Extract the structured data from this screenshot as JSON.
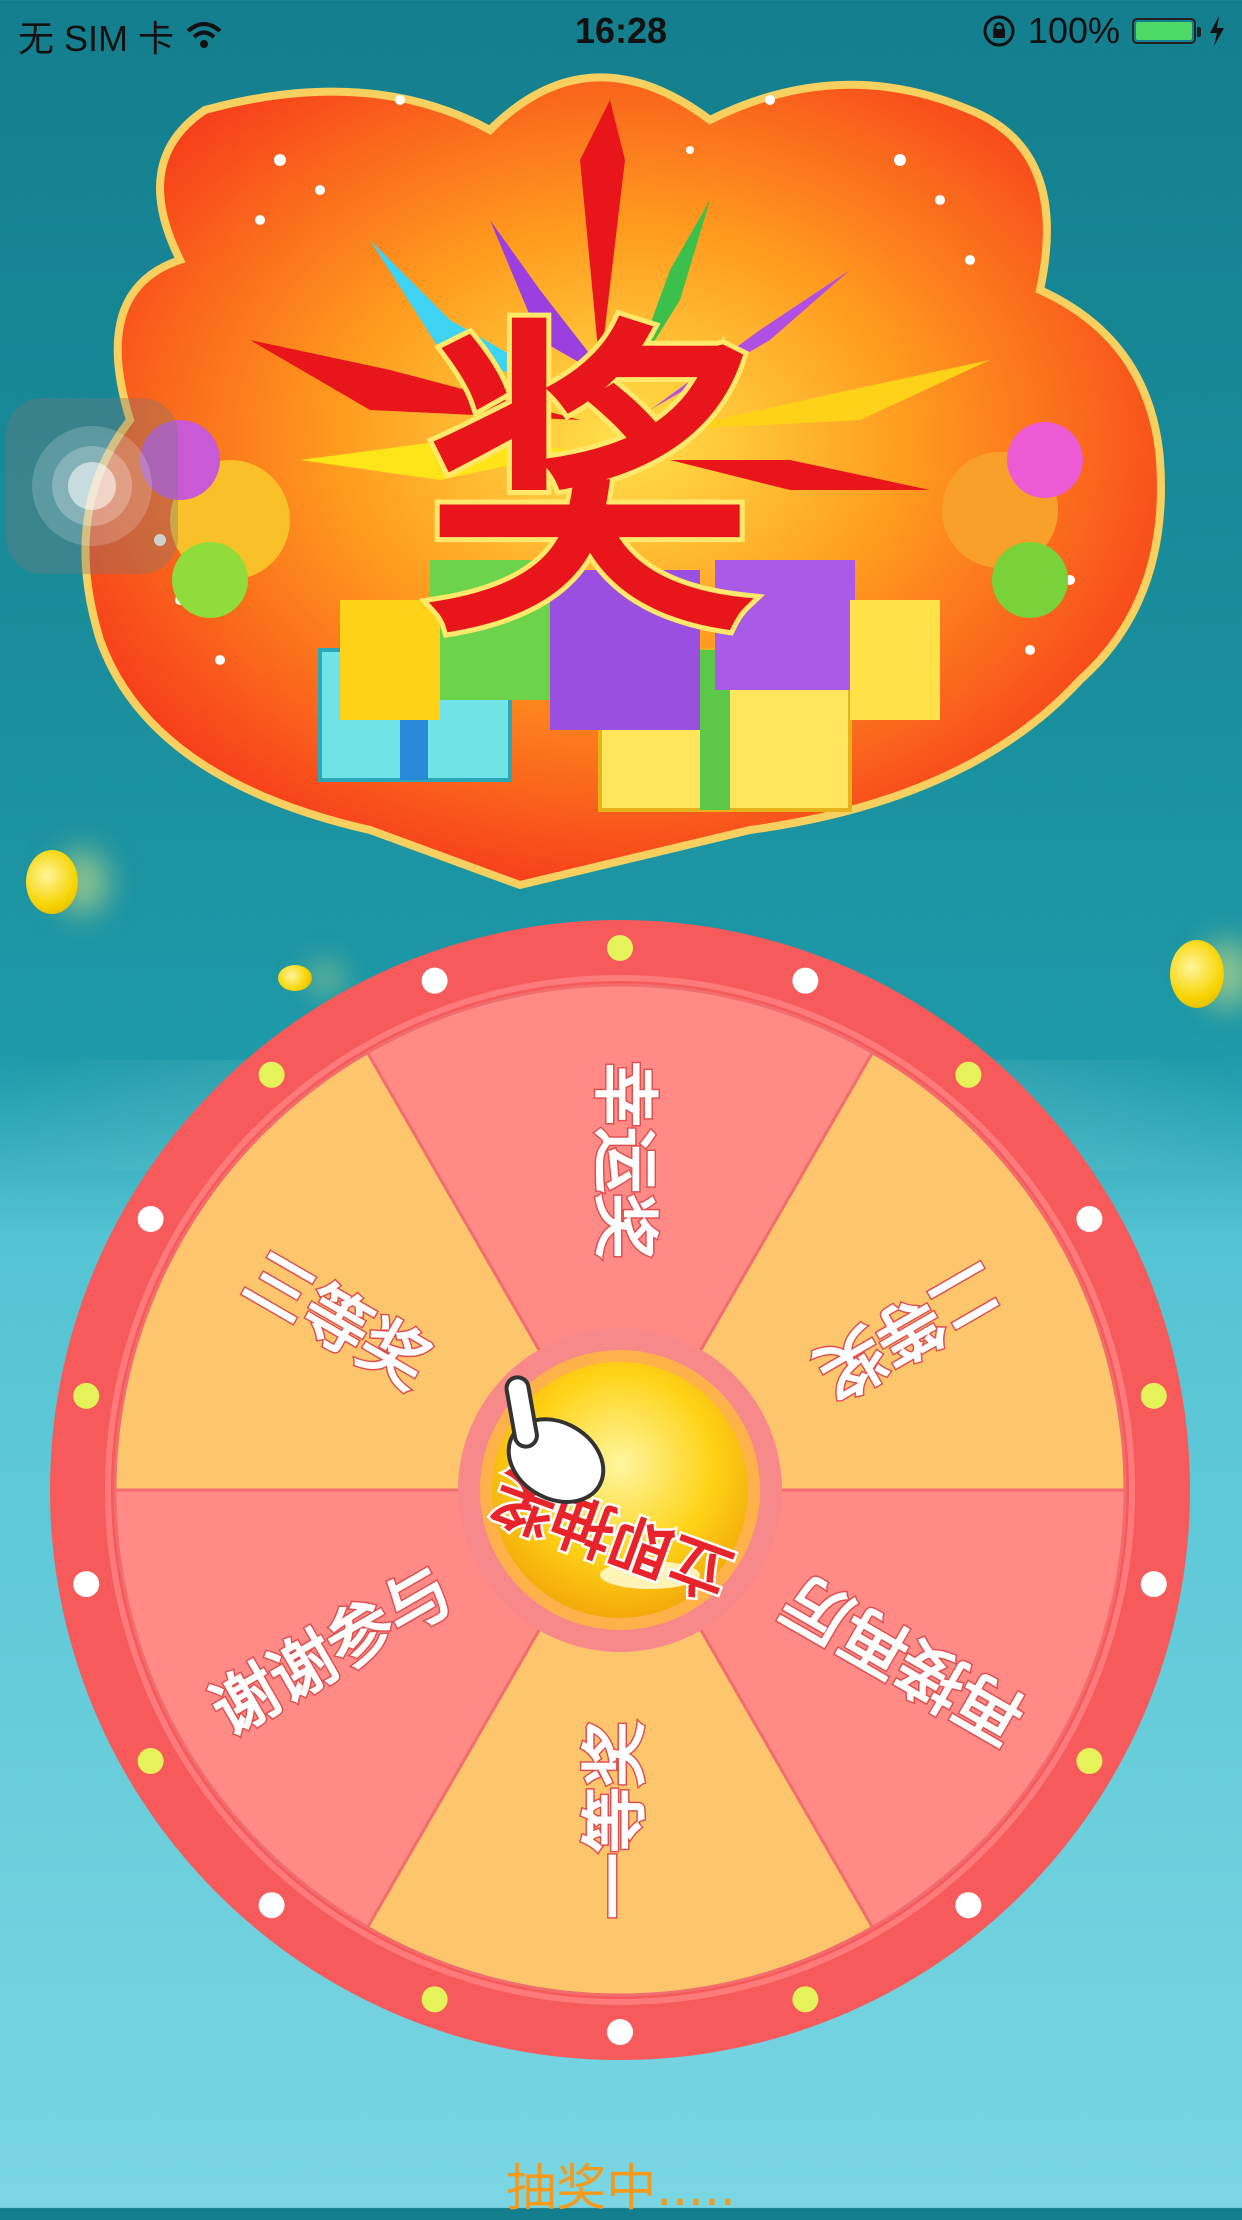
{
  "status_bar": {
    "carrier": "无 SIM 卡",
    "time": "16:28",
    "battery": "100%",
    "icons": [
      "wifi-icon",
      "rotation-lock-icon",
      "battery-icon",
      "charging-icon"
    ]
  },
  "banner": {
    "headline": "奖",
    "icon": "prize-banner-image"
  },
  "wheel": {
    "center_button_label": "立即抽奖",
    "pointer_icon": "hand-pointer-icon",
    "segments": [
      {
        "label": "幸运奖",
        "color": "#ff8a86"
      },
      {
        "label": "二等奖",
        "color": "#fdc66c"
      },
      {
        "label": "再接再厉",
        "color": "#ff8a86"
      },
      {
        "label": "一等奖",
        "color": "#fdc66c"
      },
      {
        "label": "谢谢参与",
        "color": "#ff8a86"
      },
      {
        "label": "三等奖",
        "color": "#fdc66c"
      }
    ],
    "rim_color": "#f65a5a"
  },
  "message": "抽奖中....."
}
